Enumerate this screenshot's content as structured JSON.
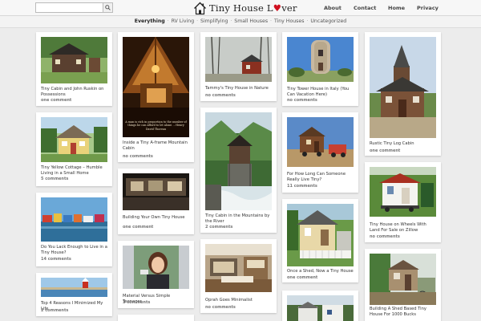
{
  "header": {
    "search": {
      "placeholder": "",
      "value": ""
    },
    "logo": {
      "part1": "Tiny House L",
      "heart": "♥",
      "part2": "ver"
    },
    "nav": [
      "About",
      "Contact",
      "Home",
      "Privacy"
    ]
  },
  "categories": [
    "Everything",
    "RV Living",
    "Simplifying",
    "Small Houses",
    "Tiny Houses",
    "Uncategorized"
  ],
  "pins": [
    {
      "caption": "Tiny Cabin and John Ruskin on Possessions",
      "comments": "one comment"
    },
    {
      "caption": "Tiny Yellow Cottage – Humble Living in a Small Home",
      "comments": "5 comments"
    },
    {
      "caption": "Do You Lack Enough to Live in a Tiny House?",
      "comments": "14 comments"
    },
    {
      "caption": "Top 4 Reasons I Minimized My Life",
      "comments": "2 comments"
    },
    {
      "caption": "Inside a Tiny A-frame Mountain Cabin",
      "comments": "no comments",
      "quote": "A man is rich in proportion to the number of things he can afford to let alone. – Henry David Thoreau"
    },
    {
      "caption": "Building Your Own Tiny House",
      "comments": "one comment"
    },
    {
      "caption": "Material Versus Simple Teenager",
      "comments": "3 comments"
    },
    {
      "caption": "Tammy's Tiny House in Nature",
      "comments": "no comments"
    },
    {
      "caption": "Tiny Cabin in the Mountains by the River",
      "comments": "2 comments"
    },
    {
      "caption": "Oprah Goes Minimalist",
      "comments": "no comments"
    },
    {
      "caption": "Tiny Tower House in Italy (You Can Vacation Here)",
      "comments": "no comments"
    },
    {
      "caption": "For How Long Can Someone Really Live Tiny?",
      "comments": "11 comments"
    },
    {
      "caption": "Once a Shed, Now a Tiny House",
      "comments": "one comment"
    },
    {
      "caption": "Rustic Tiny Log Cabin",
      "comments": "one comment"
    },
    {
      "caption": "Tiny House on Wheels With Land For Sale on Zillow",
      "comments": "no comments"
    },
    {
      "caption": "Building A Shed Based Tiny House For 1000 Bucks",
      "comments": ""
    }
  ]
}
